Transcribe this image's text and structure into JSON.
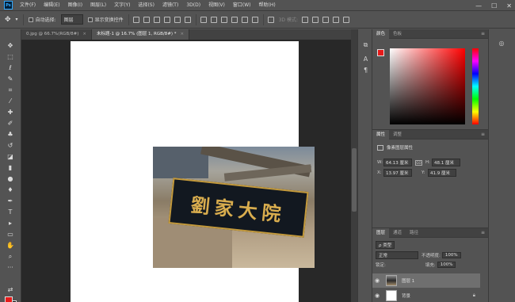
{
  "app": {
    "logo_text": "Ps"
  },
  "menu": [
    "文件(F)",
    "编辑(E)",
    "图像(I)",
    "图层(L)",
    "文字(Y)",
    "选择(S)",
    "滤镜(T)",
    "3D(D)",
    "视图(V)",
    "窗口(W)",
    "帮助(H)"
  ],
  "window_controls": {
    "minimize": "—",
    "maximize": "☐",
    "close": "✕"
  },
  "options": {
    "auto_select_label": "自动选择:",
    "auto_select_value": "图层",
    "show_transform_label": "显示变换控件",
    "mode_3d": "3D 模式:"
  },
  "tabs": [
    {
      "label": "0.jpg @ 66.7%(RGB/8#)",
      "active": false
    },
    {
      "label": "未标题-1 @ 16.7% (图层 1, RGB/8#) *",
      "active": true
    }
  ],
  "canvas": {
    "sign_text": "劉家大院"
  },
  "color_panel": {
    "tabs": [
      "颜色",
      "色板"
    ],
    "fg": "#e61a1a",
    "bg": "#1a1a1a"
  },
  "properties": {
    "tabs": [
      "属性",
      "调整"
    ],
    "header": "像素图层属性",
    "w_label": "W:",
    "w_value": "64.13 厘米",
    "h_label": "H:",
    "h_value": "48.1 厘米",
    "x_label": "X:",
    "x_value": "13.97 厘米",
    "y_label": "Y:",
    "y_value": "41.9 厘米",
    "link_glyph": "GO"
  },
  "layers": {
    "tabs": [
      "图层",
      "通道",
      "路径"
    ],
    "filter_label": "ρ 类型",
    "blend_mode": "正常",
    "opacity_label": "不透明度:",
    "opacity_value": "100%",
    "lock_label": "锁定:",
    "fill_label": "填充:",
    "fill_value": "100%",
    "items": [
      {
        "name": "图层 1",
        "selected": true
      },
      {
        "name": "背景",
        "selected": false
      }
    ]
  }
}
